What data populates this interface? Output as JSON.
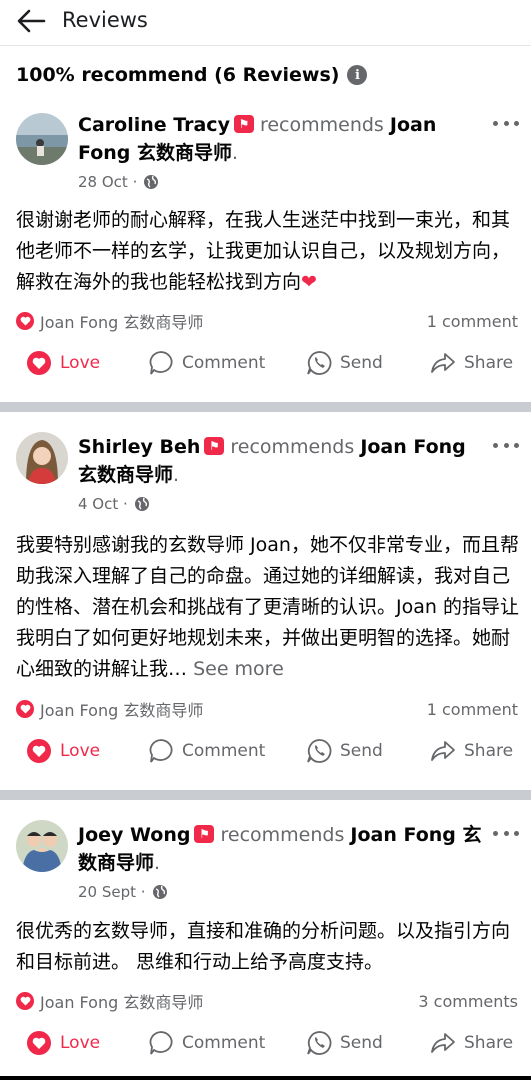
{
  "header": {
    "title": "Reviews"
  },
  "summary": {
    "text": "100% recommend (6 Reviews)",
    "info_icon": "info-icon"
  },
  "colors": {
    "love": "#f02849",
    "muted": "#65676b",
    "separator": "#c9ccd1"
  },
  "reviews": [
    {
      "name": "Caroline Tracy",
      "recommends": "recommends",
      "page": "Joan Fong 玄数商导师",
      "date": "28 Oct",
      "text": "很谢谢老师的耐心解释，在我人生迷茫中找到一束光，和其他老师不一样的玄学，让我更加认识自己，以及规划方向，解救在海外的我也能轻松找到方向",
      "heart_emoji": "❤",
      "reaction_by": "Joan Fong 玄数商导师",
      "comments": "1 comment"
    },
    {
      "name": "Shirley Beh",
      "recommends": "recommends",
      "page": "Joan Fong 玄数商导师",
      "date": "4 Oct",
      "text": "我要特别感谢我的玄数导师 Joan，她不仅非常专业，而且帮助我深入理解了自己的命盘。通过她的详细解读，我对自己的性格、潜在机会和挑战有了更清晰的认识。Joan 的指导让我明白了如何更好地规划未来，并做出更明智的选择。她耐心细致的讲解让我…",
      "see_more": "See more",
      "reaction_by": "Joan Fong 玄数商导师",
      "comments": "1 comment"
    },
    {
      "name": "Joey Wong",
      "recommends": "recommends",
      "page": "Joan Fong 玄数商导师",
      "date": "20 Sept",
      "text": "很优秀的玄数导师，直接和准确的分析问题。以及指引方向和目标前进。 思维和行动上给予高度支持。",
      "reaction_by": "Joan Fong 玄数商导师",
      "comments": "3 comments"
    }
  ],
  "actions": {
    "love": "Love",
    "comment": "Comment",
    "send": "Send",
    "share": "Share"
  }
}
